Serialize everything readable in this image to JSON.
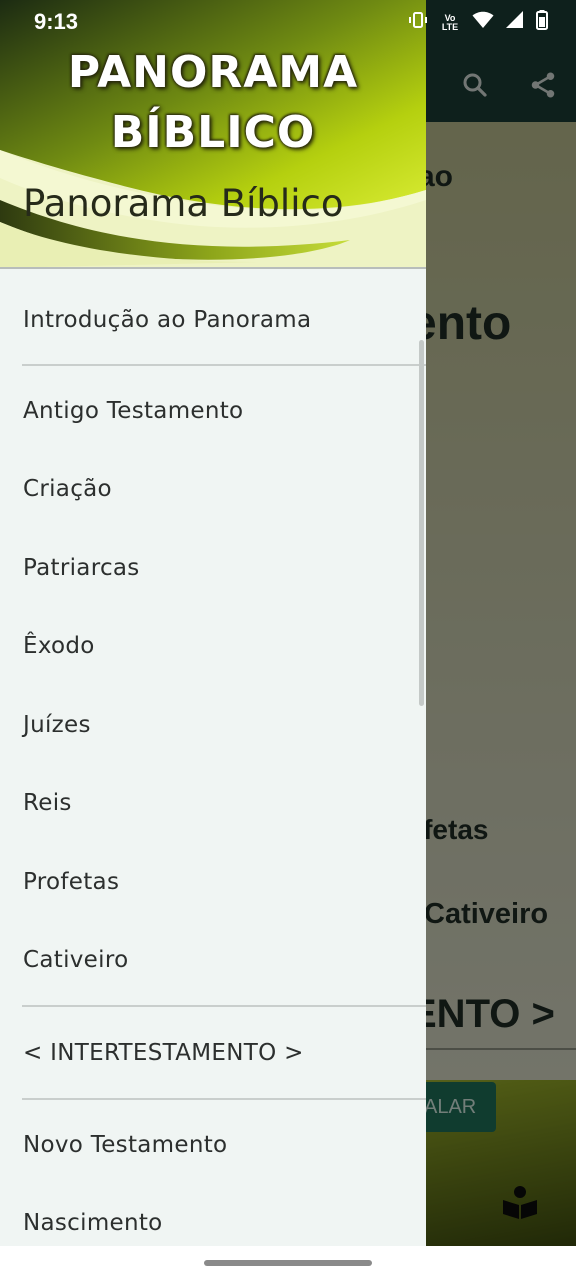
{
  "status_bar": {
    "time": "9:13",
    "icons": [
      "vibrate-icon",
      "volte-icon",
      "wifi-icon",
      "signal-icon",
      "battery-icon"
    ],
    "volte_label": "Vo LTE"
  },
  "background": {
    "partial_texts": [
      "ao",
      "ento",
      "ofetas",
      "Cativeiro",
      "ENTO >",
      "ALAR"
    ],
    "app_bar_color": "#1b3b33",
    "button_color": "#1e6e57"
  },
  "drawer": {
    "header": {
      "logo_line1": "PANORAMA",
      "logo_line2": "BÍBLICO",
      "subtitle": "Panorama Bíblico"
    },
    "items": [
      {
        "label": "Introdução ao Panorama"
      },
      {
        "label": "Antigo Testamento"
      },
      {
        "label": "Criação"
      },
      {
        "label": "Patriarcas"
      },
      {
        "label": "Êxodo"
      },
      {
        "label": "Juízes"
      },
      {
        "label": "Reis"
      },
      {
        "label": "Profetas"
      },
      {
        "label": "Cativeiro"
      },
      {
        "label": "< INTERTESTAMENTO >"
      },
      {
        "label": "Novo Testamento"
      },
      {
        "label": "Nascimento"
      }
    ],
    "background_color": "#f0f5f3",
    "accent_color": "#a6c21a"
  }
}
